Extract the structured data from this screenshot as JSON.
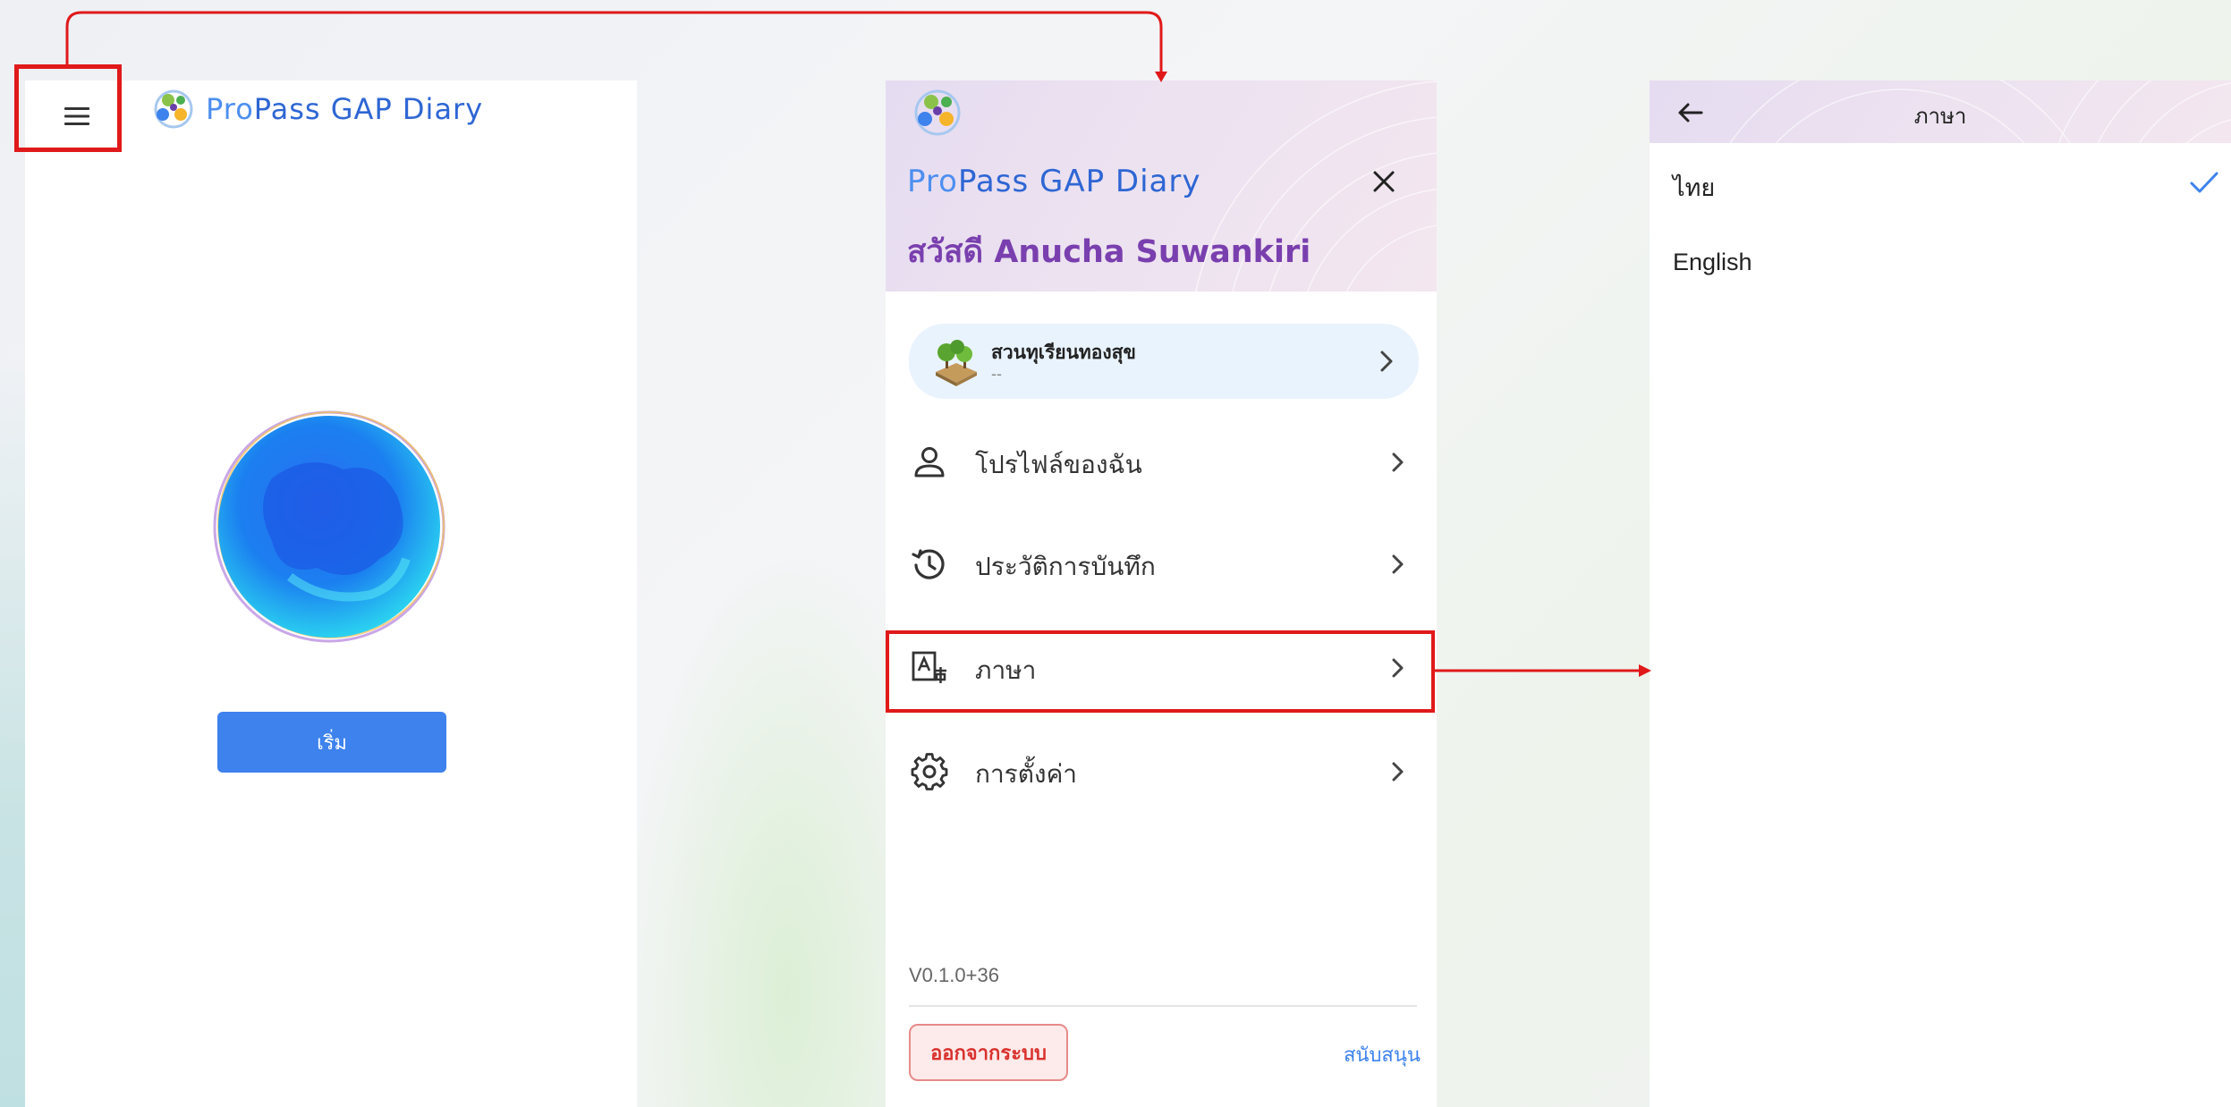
{
  "colors": {
    "accent": "#3d82ed",
    "highlight": "#e0191a",
    "greeting": "#7a3fae",
    "logout_text": "#d9312d",
    "check": "#3d82ed"
  },
  "home": {
    "menu_icon": "hamburger-menu-icon",
    "logo_icon": "propass-logo",
    "brand_prefix": "Pro",
    "brand_rest": "Pass GAP Diary",
    "start_button": "เริ่ม"
  },
  "drawer": {
    "logo_icon": "propass-logo",
    "brand_prefix": "Pro",
    "brand_rest": "Pass GAP Diary",
    "close_icon": "close-icon",
    "greeting": "สวัสดี Anucha Suwankiri",
    "farm": {
      "name": "สวนทุเรียนทองสุข",
      "subtitle": "--",
      "icon": "farm-icon"
    },
    "items": [
      {
        "label": "โปรไฟล์ของฉัน",
        "icon": "person-icon"
      },
      {
        "label": "ประวัติการบันทึก",
        "icon": "history-icon"
      },
      {
        "label": "ภาษา",
        "icon": "translate-icon"
      },
      {
        "label": "การตั้งค่า",
        "icon": "gear-icon"
      }
    ],
    "version": "V0.1.0+36",
    "logout_label": "ออกจากระบบ",
    "support_label": "สนับสนุน"
  },
  "language": {
    "back_icon": "back-arrow-icon",
    "title": "ภาษา",
    "options": [
      {
        "label": "ไทย",
        "selected": true
      },
      {
        "label": "English",
        "selected": false
      }
    ]
  }
}
